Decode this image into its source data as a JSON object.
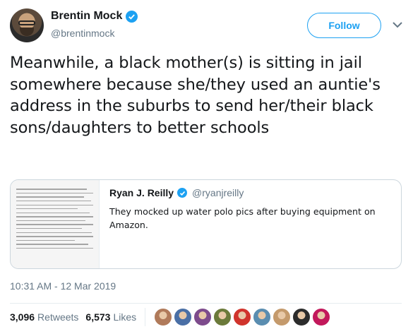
{
  "author": {
    "display_name": "Brentin Mock",
    "handle": "@brentinmock",
    "verified_icon": "verified-badge-icon"
  },
  "actions": {
    "follow_label": "Follow",
    "more_icon": "chevron-down-icon"
  },
  "tweet": {
    "text": "Meanwhile, a black mother(s) is sitting in jail somewhere because she/they used an auntie's address in the suburbs to send her/their black sons/daughters to better schools",
    "timestamp": "10:31 AM - 12 Mar 2019"
  },
  "quoted_tweet": {
    "display_name": "Ryan J. Reilly",
    "handle": "@ryanjreilly",
    "text": "They mocked up water polo pics after buying equipment on Amazon."
  },
  "stats": {
    "retweets_count": "3,096",
    "retweets_label": "Retweets",
    "likes_count": "6,573",
    "likes_label": "Likes"
  },
  "colors": {
    "accent": "#1da1f2",
    "text": "#14171a",
    "muted": "#657786",
    "border": "#e6ecf0"
  },
  "likers": [
    {
      "color": "#b07a5a",
      "label": "liker-avatar-1"
    },
    {
      "color": "#4a6fa5",
      "label": "liker-avatar-2"
    },
    {
      "color": "#7d4b8c",
      "label": "liker-avatar-3"
    },
    {
      "color": "#6b7a3a",
      "label": "liker-avatar-4"
    },
    {
      "color": "#d0342c",
      "label": "liker-avatar-5"
    },
    {
      "color": "#5a8db0",
      "label": "liker-avatar-6"
    },
    {
      "color": "#c49a6c",
      "label": "liker-avatar-7"
    },
    {
      "color": "#2c2c2c",
      "label": "liker-avatar-8"
    },
    {
      "color": "#c2185b",
      "label": "liker-avatar-9"
    }
  ]
}
